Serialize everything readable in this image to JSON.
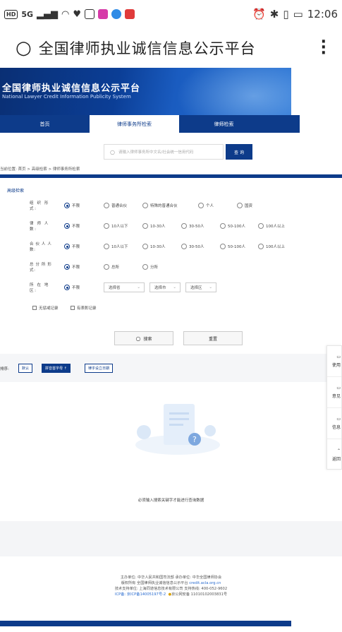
{
  "status_bar": {
    "hd": "HD",
    "signal": "5G",
    "time": "12:06"
  },
  "browser": {
    "title": "全国律师执业诚信信息公示平台"
  },
  "banner": {
    "title_cn": "全国律师执业诚信信息公示平台",
    "title_en": "National Lawyer Credit Information Publicity System"
  },
  "nav": {
    "tabs": [
      "首页",
      "律师事务所检索",
      "律师检索"
    ],
    "active_index": 1
  },
  "search": {
    "placeholder": "请输入律师事务所中文名/社会统一信用代码",
    "button": "查 询"
  },
  "breadcrumb": "当前位置: 首页 > 高级检索 > 律师事务所检索",
  "advanced": {
    "heading": "高级检索",
    "rows": [
      {
        "label": "组 织 形 式:",
        "options": [
          "不限",
          "普通合伙",
          "特殊的普通合伙",
          "个人",
          "国资"
        ],
        "selected": 0
      },
      {
        "label": "律 师 人 数:",
        "options": [
          "不限",
          "10人以下",
          "10-30人",
          "30-50人",
          "50-100人",
          "100人以上"
        ],
        "selected": 0
      },
      {
        "label": "合 伙 人 人 数:",
        "options": [
          "不限",
          "10人以下",
          "10-30人",
          "30-50人",
          "50-100人",
          "100人以上"
        ],
        "selected": 0
      },
      {
        "label": "总 分 所 形 式:",
        "options": [
          "不限",
          "总所",
          "分所"
        ],
        "selected": 0
      }
    ],
    "region": {
      "label": "所 在 地 区:",
      "option": "不限",
      "province": "选择省",
      "city": "选择市",
      "district": "选择区"
    },
    "checkboxes": [
      "无惩戒记录",
      "有表彰记录"
    ],
    "search_btn": "搜索",
    "reset_btn": "重置"
  },
  "sort": {
    "label": "排序:",
    "options": [
      "默认",
      "拼音首字母 ↑",
      "律乎设立日期"
    ],
    "active_index": 1
  },
  "side_tools": [
    "使用",
    "意见",
    "信息",
    "返回"
  ],
  "empty_message": "必须输入搜索关键字才能进行查询数据",
  "footer": {
    "line1": "主办单位: 中华人民共和国司法部 承办单位: 中华全国律师协会",
    "line2_prefix": "版权所有 全国律师执业诚信信息公示平台",
    "line2_link": "credit.acla.org.cn",
    "line3": "技术支持单位: 上海同道信息技术有限公司 支持热线: 400-052-9602",
    "icp": "ICP备: 京ICP备14005197号-2",
    "police": "京公网安备 11010102003831号"
  }
}
